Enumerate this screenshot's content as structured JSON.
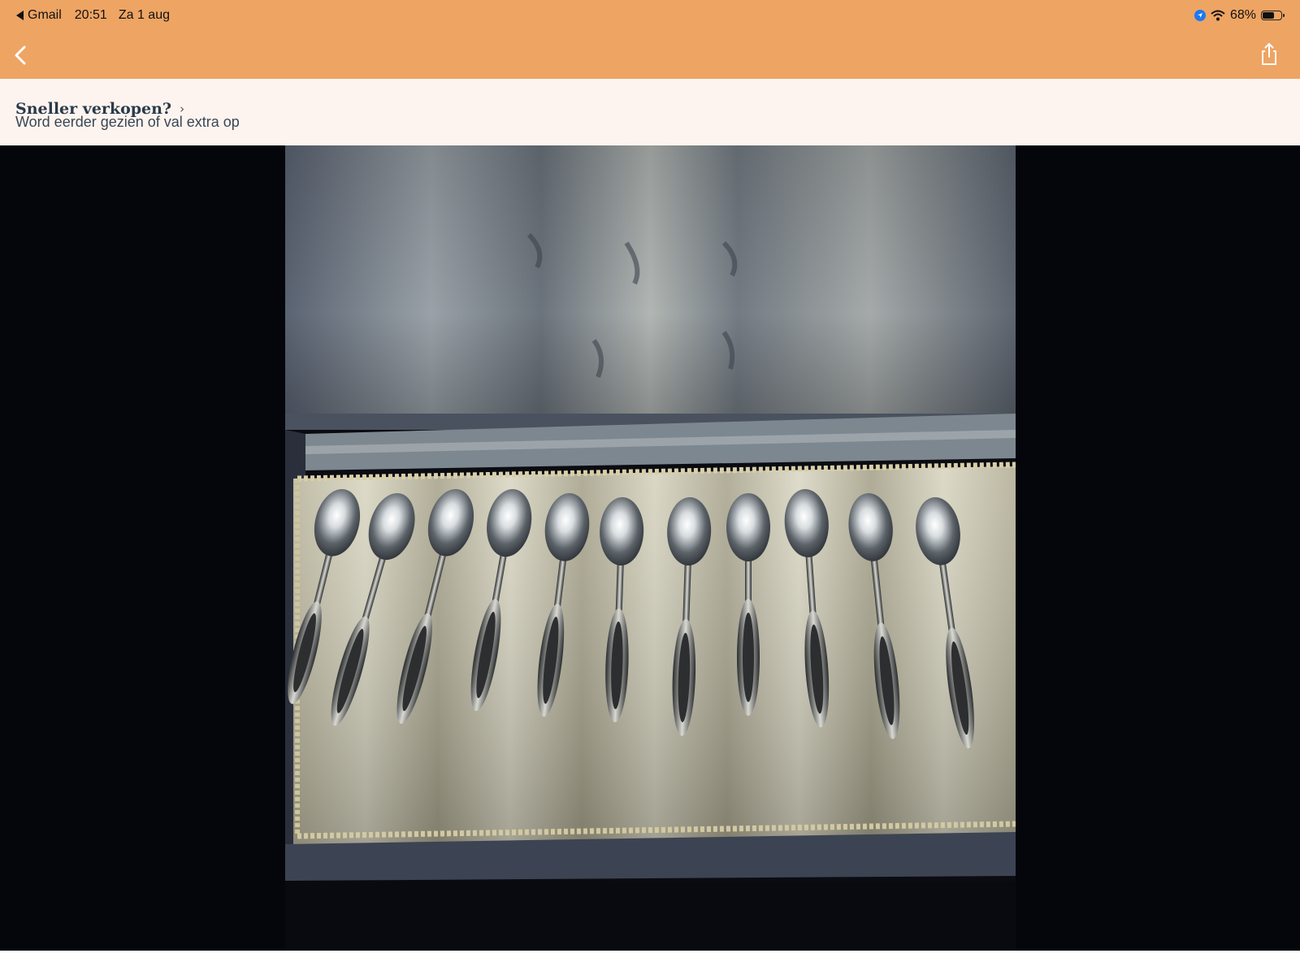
{
  "status_bar": {
    "back_app": "Gmail",
    "time": "20:51",
    "date": "Za 1 aug",
    "battery_text": "68%",
    "battery_level": 0.68,
    "icons": [
      "back-arrow-icon",
      "location-icon",
      "wifi-icon",
      "battery-icon"
    ]
  },
  "navbar": {
    "back_icon": "chevron-left-icon",
    "share_icon": "share-icon"
  },
  "promo": {
    "title": "Sneller verkopen?",
    "chevron": "›",
    "subtitle": "Word eerder gezien of val extra op"
  },
  "photo": {
    "spoon_count": 11
  },
  "colors": {
    "header": "#eea463",
    "promo_bg": "#fdf4ef",
    "photo_bg": "#05060c"
  }
}
